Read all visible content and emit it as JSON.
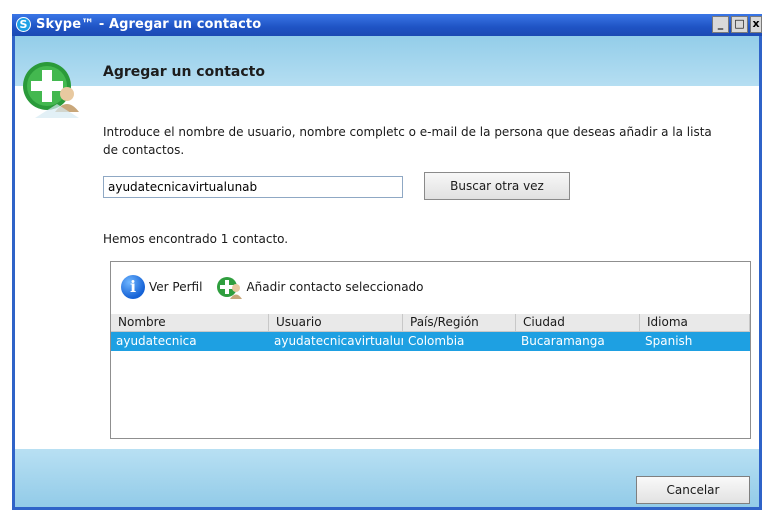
{
  "window": {
    "title": "Skype™ - Agregar un contacto",
    "minimize": "_",
    "maximize": "□",
    "close": "x"
  },
  "heading": "Agregar un contacto",
  "instructions": "Introduce el nombre de usuario, nombre completc o e-mail de la persona que deseas añadir a la lista de contactos.",
  "search": {
    "value": "ayudatecnicavirtualunab",
    "button_label": "Buscar otra vez"
  },
  "found_text": "Hemos encontrado 1 contacto.",
  "toolbar": {
    "view_profile": "Ver Perfil",
    "add_selected": "Añadir contacto seleccionado"
  },
  "table": {
    "headers": [
      "Nombre",
      "Usuario",
      "País/Región",
      "Ciudad",
      "Idioma"
    ],
    "rows": [
      [
        "ayudatecnica",
        "ayudatecnicavirtualun",
        "Colombia",
        "Bucaramanga",
        "Spanish"
      ]
    ]
  },
  "cancel_label": "Cancelar",
  "colors": {
    "selection": "#1ea0e2",
    "band": "#a9d8ef",
    "titlebar": "#1f53c4"
  }
}
